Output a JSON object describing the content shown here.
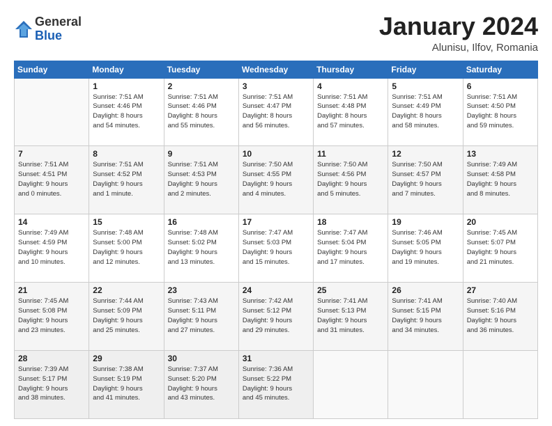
{
  "header": {
    "logo_general": "General",
    "logo_blue": "Blue",
    "title": "January 2024",
    "location": "Alunisu, Ilfov, Romania"
  },
  "weekdays": [
    "Sunday",
    "Monday",
    "Tuesday",
    "Wednesday",
    "Thursday",
    "Friday",
    "Saturday"
  ],
  "weeks": [
    [
      {
        "day": "",
        "info": ""
      },
      {
        "day": "1",
        "info": "Sunrise: 7:51 AM\nSunset: 4:46 PM\nDaylight: 8 hours\nand 54 minutes."
      },
      {
        "day": "2",
        "info": "Sunrise: 7:51 AM\nSunset: 4:46 PM\nDaylight: 8 hours\nand 55 minutes."
      },
      {
        "day": "3",
        "info": "Sunrise: 7:51 AM\nSunset: 4:47 PM\nDaylight: 8 hours\nand 56 minutes."
      },
      {
        "day": "4",
        "info": "Sunrise: 7:51 AM\nSunset: 4:48 PM\nDaylight: 8 hours\nand 57 minutes."
      },
      {
        "day": "5",
        "info": "Sunrise: 7:51 AM\nSunset: 4:49 PM\nDaylight: 8 hours\nand 58 minutes."
      },
      {
        "day": "6",
        "info": "Sunrise: 7:51 AM\nSunset: 4:50 PM\nDaylight: 8 hours\nand 59 minutes."
      }
    ],
    [
      {
        "day": "7",
        "info": "Sunrise: 7:51 AM\nSunset: 4:51 PM\nDaylight: 9 hours\nand 0 minutes."
      },
      {
        "day": "8",
        "info": "Sunrise: 7:51 AM\nSunset: 4:52 PM\nDaylight: 9 hours\nand 1 minute."
      },
      {
        "day": "9",
        "info": "Sunrise: 7:51 AM\nSunset: 4:53 PM\nDaylight: 9 hours\nand 2 minutes."
      },
      {
        "day": "10",
        "info": "Sunrise: 7:50 AM\nSunset: 4:55 PM\nDaylight: 9 hours\nand 4 minutes."
      },
      {
        "day": "11",
        "info": "Sunrise: 7:50 AM\nSunset: 4:56 PM\nDaylight: 9 hours\nand 5 minutes."
      },
      {
        "day": "12",
        "info": "Sunrise: 7:50 AM\nSunset: 4:57 PM\nDaylight: 9 hours\nand 7 minutes."
      },
      {
        "day": "13",
        "info": "Sunrise: 7:49 AM\nSunset: 4:58 PM\nDaylight: 9 hours\nand 8 minutes."
      }
    ],
    [
      {
        "day": "14",
        "info": "Sunrise: 7:49 AM\nSunset: 4:59 PM\nDaylight: 9 hours\nand 10 minutes."
      },
      {
        "day": "15",
        "info": "Sunrise: 7:48 AM\nSunset: 5:00 PM\nDaylight: 9 hours\nand 12 minutes."
      },
      {
        "day": "16",
        "info": "Sunrise: 7:48 AM\nSunset: 5:02 PM\nDaylight: 9 hours\nand 13 minutes."
      },
      {
        "day": "17",
        "info": "Sunrise: 7:47 AM\nSunset: 5:03 PM\nDaylight: 9 hours\nand 15 minutes."
      },
      {
        "day": "18",
        "info": "Sunrise: 7:47 AM\nSunset: 5:04 PM\nDaylight: 9 hours\nand 17 minutes."
      },
      {
        "day": "19",
        "info": "Sunrise: 7:46 AM\nSunset: 5:05 PM\nDaylight: 9 hours\nand 19 minutes."
      },
      {
        "day": "20",
        "info": "Sunrise: 7:45 AM\nSunset: 5:07 PM\nDaylight: 9 hours\nand 21 minutes."
      }
    ],
    [
      {
        "day": "21",
        "info": "Sunrise: 7:45 AM\nSunset: 5:08 PM\nDaylight: 9 hours\nand 23 minutes."
      },
      {
        "day": "22",
        "info": "Sunrise: 7:44 AM\nSunset: 5:09 PM\nDaylight: 9 hours\nand 25 minutes."
      },
      {
        "day": "23",
        "info": "Sunrise: 7:43 AM\nSunset: 5:11 PM\nDaylight: 9 hours\nand 27 minutes."
      },
      {
        "day": "24",
        "info": "Sunrise: 7:42 AM\nSunset: 5:12 PM\nDaylight: 9 hours\nand 29 minutes."
      },
      {
        "day": "25",
        "info": "Sunrise: 7:41 AM\nSunset: 5:13 PM\nDaylight: 9 hours\nand 31 minutes."
      },
      {
        "day": "26",
        "info": "Sunrise: 7:41 AM\nSunset: 5:15 PM\nDaylight: 9 hours\nand 34 minutes."
      },
      {
        "day": "27",
        "info": "Sunrise: 7:40 AM\nSunset: 5:16 PM\nDaylight: 9 hours\nand 36 minutes."
      }
    ],
    [
      {
        "day": "28",
        "info": "Sunrise: 7:39 AM\nSunset: 5:17 PM\nDaylight: 9 hours\nand 38 minutes."
      },
      {
        "day": "29",
        "info": "Sunrise: 7:38 AM\nSunset: 5:19 PM\nDaylight: 9 hours\nand 41 minutes."
      },
      {
        "day": "30",
        "info": "Sunrise: 7:37 AM\nSunset: 5:20 PM\nDaylight: 9 hours\nand 43 minutes."
      },
      {
        "day": "31",
        "info": "Sunrise: 7:36 AM\nSunset: 5:22 PM\nDaylight: 9 hours\nand 45 minutes."
      },
      {
        "day": "",
        "info": ""
      },
      {
        "day": "",
        "info": ""
      },
      {
        "day": "",
        "info": ""
      }
    ]
  ]
}
